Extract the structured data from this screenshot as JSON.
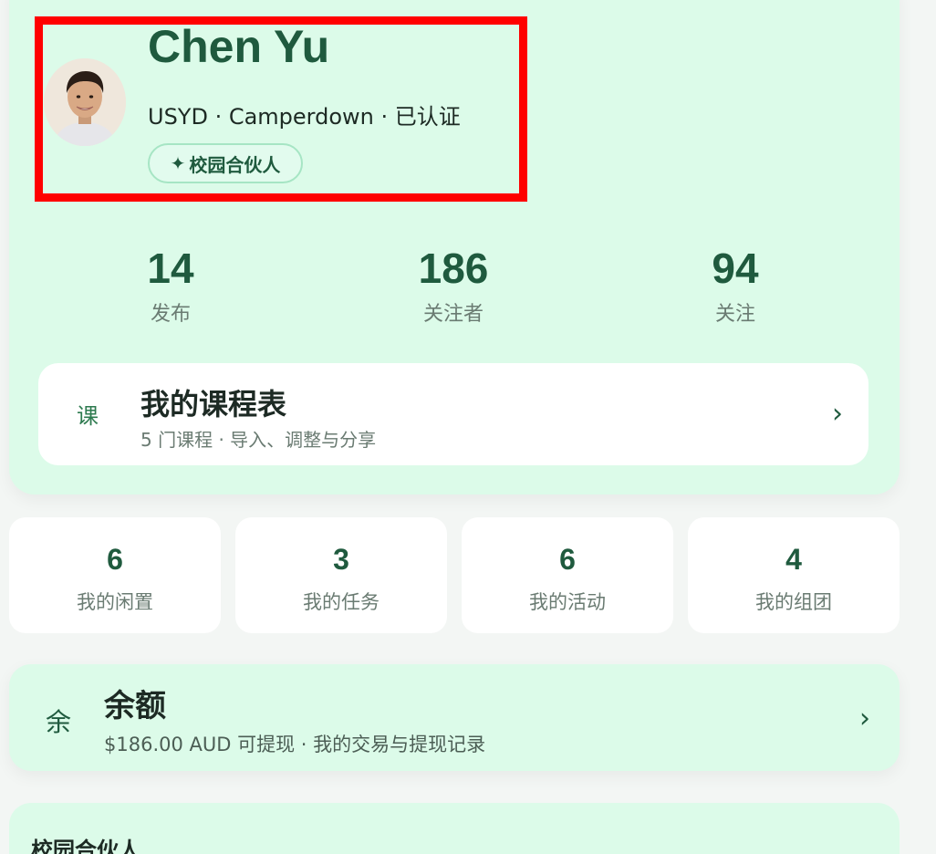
{
  "profile": {
    "name": "Chen Yu",
    "subline": "USYD · Camperdown · 已认证",
    "badge_icon": "✦",
    "badge_label": "校园合伙人",
    "avatar_icon": "avatar-photo"
  },
  "stats": [
    {
      "value": "14",
      "label": "发布"
    },
    {
      "value": "186",
      "label": "关注者"
    },
    {
      "value": "94",
      "label": "关注"
    }
  ],
  "schedule": {
    "icon": "课",
    "title": "我的课程表",
    "subtitle": "5 门课程 · 导入、调整与分享",
    "chevron": "›"
  },
  "tiles": [
    {
      "value": "6",
      "label": "我的闲置"
    },
    {
      "value": "3",
      "label": "我的任务"
    },
    {
      "value": "6",
      "label": "我的活动"
    },
    {
      "value": "4",
      "label": "我的组团"
    }
  ],
  "balance": {
    "icon": "余",
    "title": "余额",
    "subtitle": "$186.00 AUD 可提现 · 我的交易与提现记录",
    "chevron": "›"
  },
  "partner_section": {
    "title": "校园合伙人"
  },
  "colors": {
    "accent": "#1f5a3e",
    "card_bg": "#dcfbe9",
    "highlight": "#ff0000"
  }
}
